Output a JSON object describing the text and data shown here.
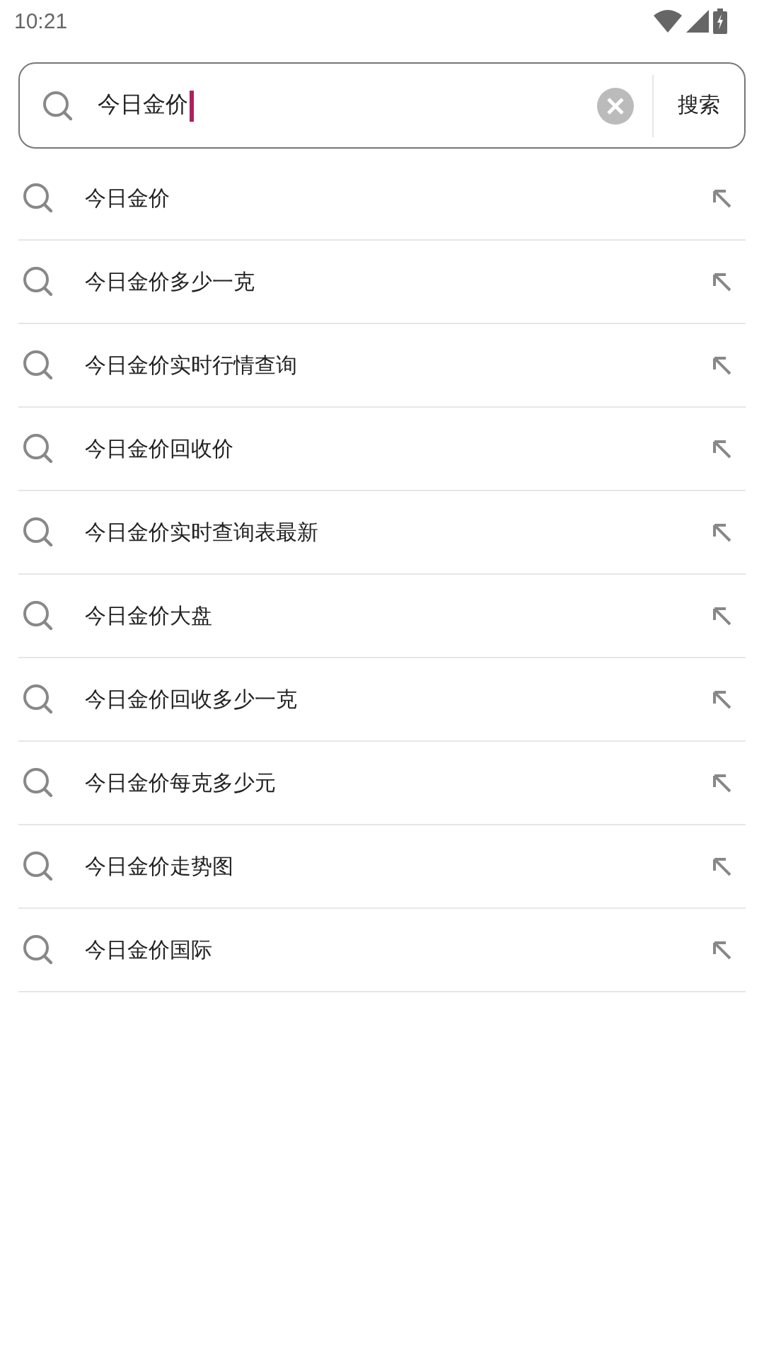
{
  "status_bar": {
    "time": "10:21"
  },
  "search": {
    "value": "今日金价",
    "button": "搜索"
  },
  "suggestions": [
    {
      "text": "今日金价"
    },
    {
      "text": "今日金价多少一克"
    },
    {
      "text": "今日金价实时行情查询"
    },
    {
      "text": "今日金价回收价"
    },
    {
      "text": "今日金价实时查询表最新"
    },
    {
      "text": "今日金价大盘"
    },
    {
      "text": "今日金价回收多少一克"
    },
    {
      "text": "今日金价每克多少元"
    },
    {
      "text": "今日金价走势图"
    },
    {
      "text": "今日金价国际"
    }
  ]
}
